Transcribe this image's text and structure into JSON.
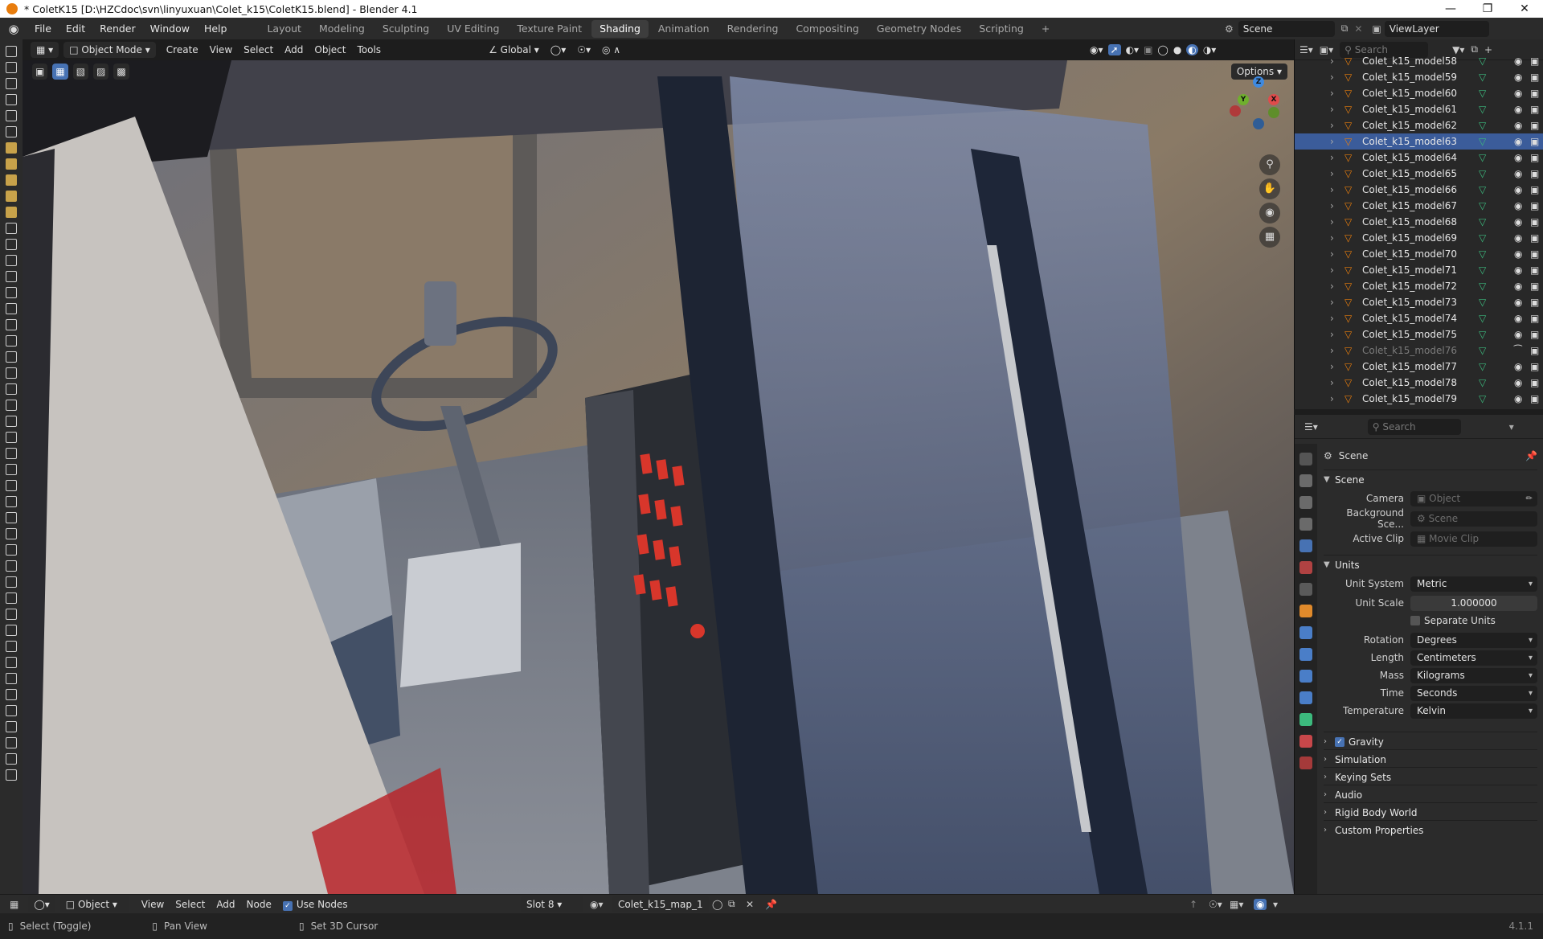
{
  "window": {
    "title": "* ColetK15 [D:\\HZCdoc\\svn\\linyuxuan\\Colet_k15\\ColetK15.blend] - Blender 4.1",
    "minimize_icon": "minimize-icon",
    "maximize_icon": "maximize-icon",
    "close_icon": "close-icon"
  },
  "menu": [
    "File",
    "Edit",
    "Render",
    "Window",
    "Help"
  ],
  "workspaces": [
    "Layout",
    "Modeling",
    "Sculpting",
    "UV Editing",
    "Texture Paint",
    "Shading",
    "Animation",
    "Rendering",
    "Compositing",
    "Geometry Nodes",
    "Scripting",
    "+"
  ],
  "active_workspace": "Shading",
  "scene_field": "Scene",
  "viewlayer_field": "ViewLayer",
  "viewport_header": {
    "mode": "Object Mode",
    "menus": [
      "Create",
      "View",
      "Select",
      "Add",
      "Object",
      "Tools"
    ],
    "transform_orientation": "Global",
    "options": "Options"
  },
  "outliner": {
    "search_placeholder": "Search",
    "items": [
      {
        "name": "Colet_k15_model58",
        "selected": false,
        "hidden": false
      },
      {
        "name": "Colet_k15_model59",
        "selected": false,
        "hidden": false
      },
      {
        "name": "Colet_k15_model60",
        "selected": false,
        "hidden": false
      },
      {
        "name": "Colet_k15_model61",
        "selected": false,
        "hidden": false
      },
      {
        "name": "Colet_k15_model62",
        "selected": false,
        "hidden": false
      },
      {
        "name": "Colet_k15_model63",
        "selected": true,
        "hidden": false
      },
      {
        "name": "Colet_k15_model64",
        "selected": false,
        "hidden": false
      },
      {
        "name": "Colet_k15_model65",
        "selected": false,
        "hidden": false
      },
      {
        "name": "Colet_k15_model66",
        "selected": false,
        "hidden": false
      },
      {
        "name": "Colet_k15_model67",
        "selected": false,
        "hidden": false
      },
      {
        "name": "Colet_k15_model68",
        "selected": false,
        "hidden": false
      },
      {
        "name": "Colet_k15_model69",
        "selected": false,
        "hidden": false
      },
      {
        "name": "Colet_k15_model70",
        "selected": false,
        "hidden": false
      },
      {
        "name": "Colet_k15_model71",
        "selected": false,
        "hidden": false
      },
      {
        "name": "Colet_k15_model72",
        "selected": false,
        "hidden": false
      },
      {
        "name": "Colet_k15_model73",
        "selected": false,
        "hidden": false
      },
      {
        "name": "Colet_k15_model74",
        "selected": false,
        "hidden": false
      },
      {
        "name": "Colet_k15_model75",
        "selected": false,
        "hidden": false
      },
      {
        "name": "Colet_k15_model76",
        "selected": false,
        "hidden": true
      },
      {
        "name": "Colet_k15_model77",
        "selected": false,
        "hidden": false
      },
      {
        "name": "Colet_k15_model78",
        "selected": false,
        "hidden": false
      },
      {
        "name": "Colet_k15_model79",
        "selected": false,
        "hidden": false
      }
    ]
  },
  "properties": {
    "search_placeholder": "Search",
    "context": "Scene",
    "scene_panel": {
      "title": "Scene",
      "camera_label": "Camera",
      "camera_placeholder": "Object",
      "background_label": "Background Sce...",
      "background_placeholder": "Scene",
      "clip_label": "Active Clip",
      "clip_placeholder": "Movie Clip"
    },
    "units_panel": {
      "title": "Units",
      "unit_system_label": "Unit System",
      "unit_system": "Metric",
      "unit_scale_label": "Unit Scale",
      "unit_scale": "1.000000",
      "separate_units": "Separate Units",
      "rotation_label": "Rotation",
      "rotation": "Degrees",
      "length_label": "Length",
      "length": "Centimeters",
      "mass_label": "Mass",
      "mass": "Kilograms",
      "time_label": "Time",
      "time": "Seconds",
      "temperature_label": "Temperature",
      "temperature": "Kelvin"
    },
    "collapsed_panels": [
      "Gravity",
      "Simulation",
      "Keying Sets",
      "Audio",
      "Rigid Body World",
      "Custom Properties"
    ]
  },
  "node_header": {
    "object_type": "Object",
    "menus": [
      "View",
      "Select",
      "Add",
      "Node"
    ],
    "use_nodes": "Use Nodes",
    "slot": "Slot 8",
    "material": "Colet_k15_map_1"
  },
  "status": {
    "select": "Select (Toggle)",
    "pan": "Pan View",
    "cursor": "Set 3D Cursor",
    "version": "4.1.1"
  },
  "colors": {
    "accent": "#4772b3",
    "selection": "#3b5c9a",
    "mesh_icon": "#e87d0d",
    "data_icon": "#3cba7d"
  }
}
